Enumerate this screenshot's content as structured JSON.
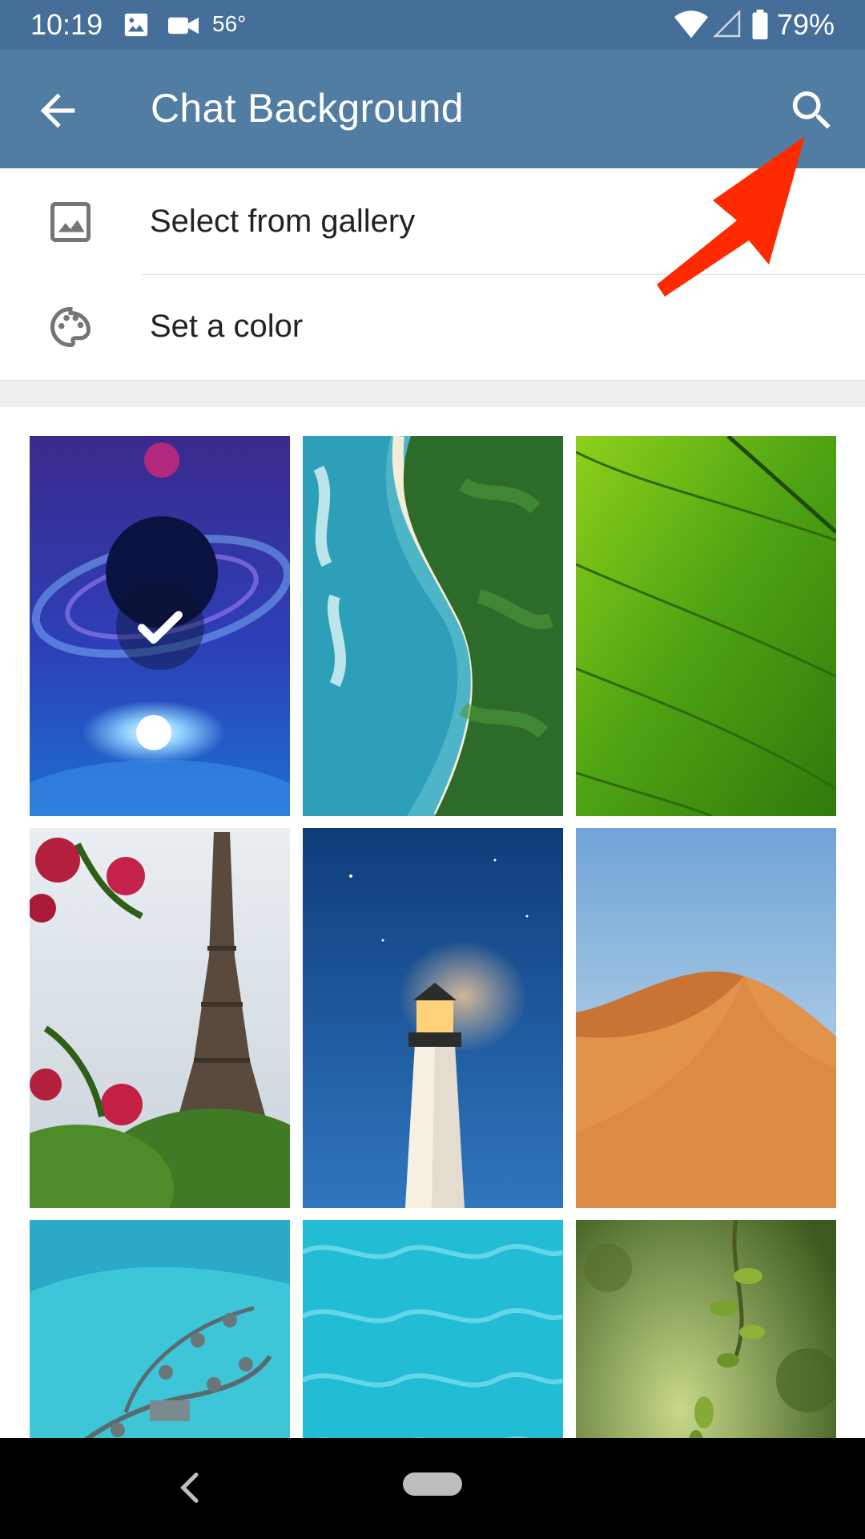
{
  "status_bar": {
    "time": "10:19",
    "temperature": "56°",
    "battery_percent": "79%",
    "icons": [
      "image-notification-icon",
      "video-camera-icon",
      "wifi-icon",
      "cellular-signal-icon",
      "battery-icon"
    ]
  },
  "app_bar": {
    "title": "Chat Background",
    "back_icon": "arrow-back-icon",
    "search_icon": "search-icon",
    "background_color": "#527da3"
  },
  "menu": [
    {
      "label": "Select from gallery",
      "icon": "image-icon"
    },
    {
      "label": "Set a color",
      "icon": "palette-icon"
    }
  ],
  "wallpapers": [
    {
      "name": "space-galaxy",
      "selected": true
    },
    {
      "name": "aerial-beach",
      "selected": false
    },
    {
      "name": "green-leaf",
      "selected": false
    },
    {
      "name": "eiffel-tower",
      "selected": false
    },
    {
      "name": "lighthouse",
      "selected": false
    },
    {
      "name": "sand-dune",
      "selected": false
    },
    {
      "name": "maldives-villas",
      "selected": false
    },
    {
      "name": "turquoise-water",
      "selected": false
    },
    {
      "name": "green-foliage",
      "selected": false
    }
  ],
  "navigation": {
    "back_icon": "nav-back-icon",
    "home_icon": "nav-home-pill"
  },
  "annotation": {
    "color": "#ff2a00",
    "points_to": "search-icon"
  }
}
